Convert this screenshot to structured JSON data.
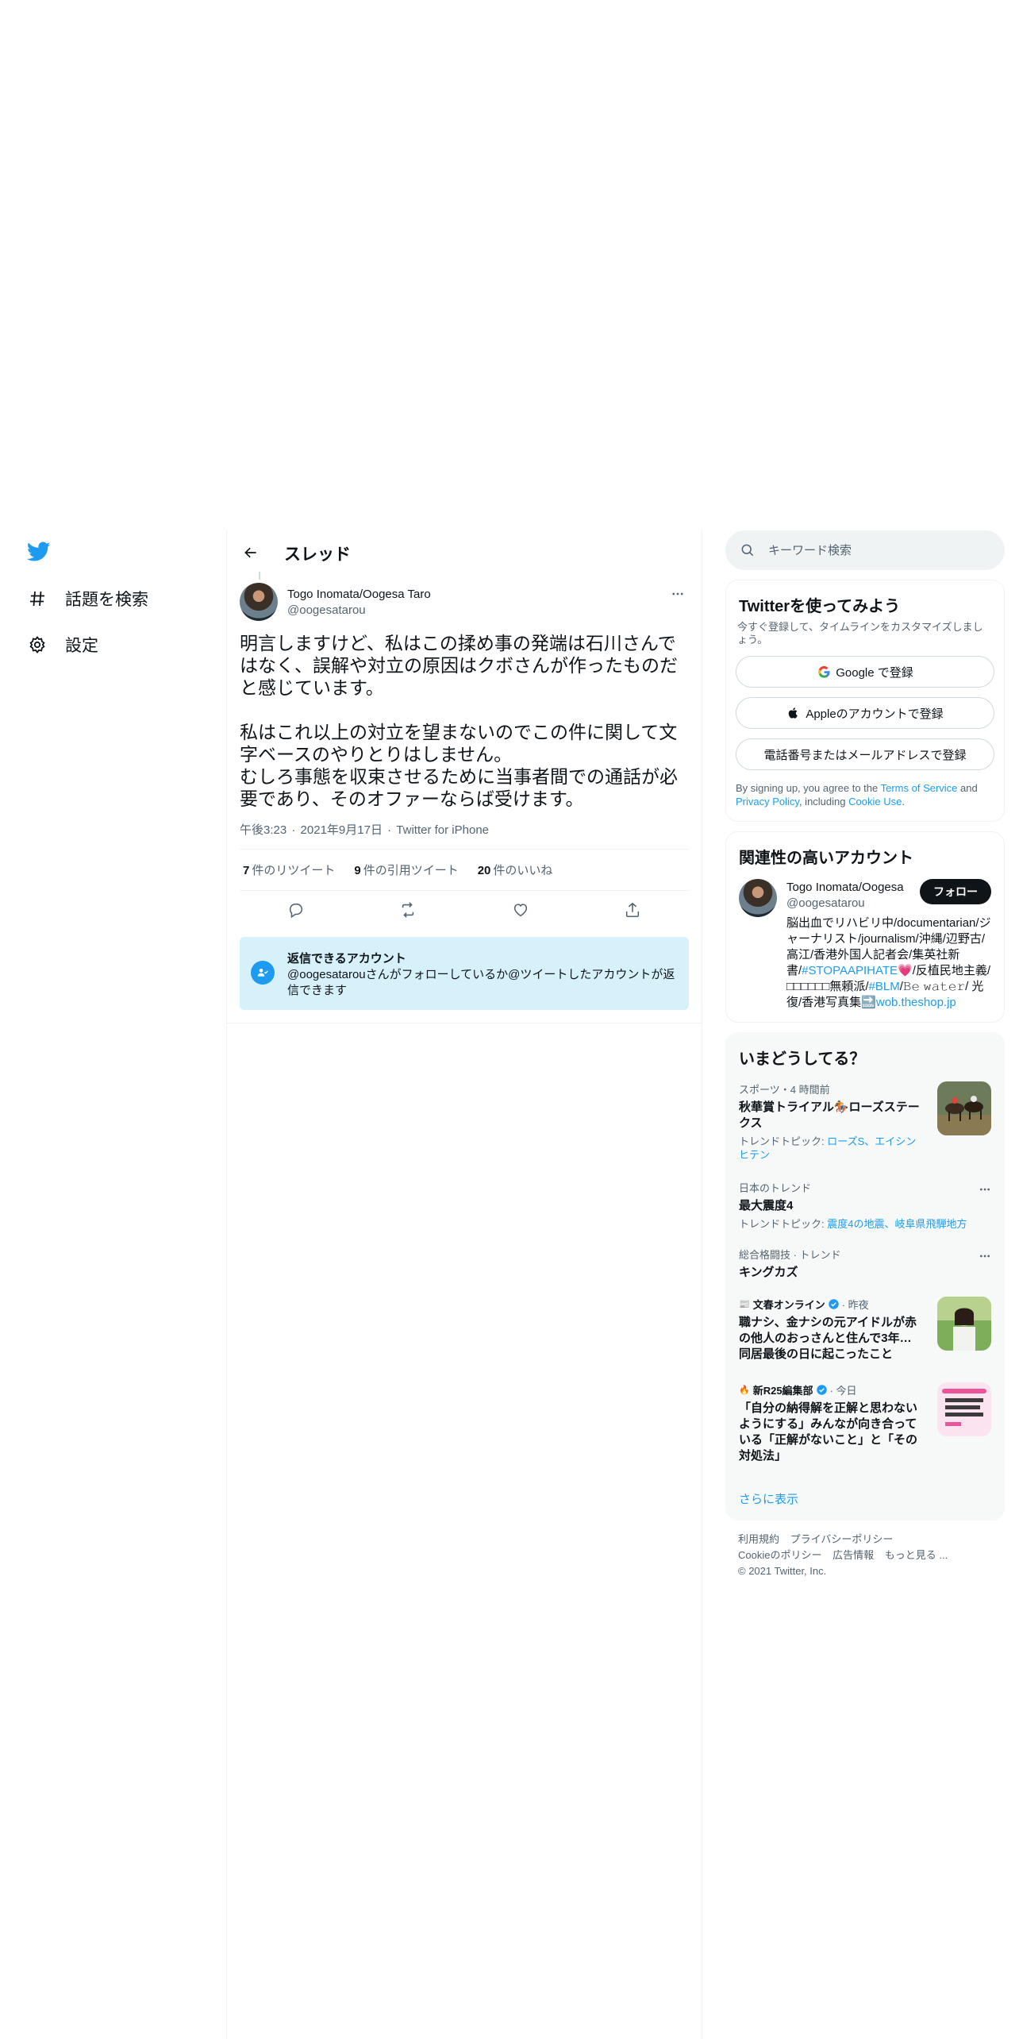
{
  "nav": {
    "logo_icon": "twitter-bird-icon",
    "items": [
      {
        "label": "話題を検索",
        "icon": "hashtag-icon"
      },
      {
        "label": "設定",
        "icon": "gear-icon"
      }
    ]
  },
  "header": {
    "title": "スレッド"
  },
  "tweet": {
    "author_name": "Togo Inomata/Oogesa Taro",
    "author_handle": "@oogesatarou",
    "text": "明言しますけど、私はこの揉め事の発端は石川さんではなく、誤解や対立の原因はクボさんが作ったものだと感じています。\n\n私はこれ以上の対立を望まないのでこの件に関して文字ベースのやりとりはしません。\nむしろ事態を収束させるために当事者間での通話が必要であり、そのオファーならば受けます。",
    "time": "午後3:23",
    "date": "2021年9月17日",
    "client": "Twitter for iPhone",
    "sep": "·",
    "retweets": {
      "count": "7",
      "label": "件のリツイート"
    },
    "quotes": {
      "count": "9",
      "label": "件の引用ツイート"
    },
    "likes": {
      "count": "20",
      "label": "件のいいね"
    }
  },
  "reply_box": {
    "title": "返信できるアカウント",
    "desc": "@oogesatarouさんがフォローしているか@ツイートしたアカウントが返信できます"
  },
  "search": {
    "placeholder": "キーワード検索"
  },
  "signup": {
    "title": "Twitterを使ってみよう",
    "sub": "今すぐ登録して、タイムラインをカスタマイズしましょう。",
    "google": "Google で登録",
    "apple": "Appleのアカウントで登録",
    "phone": "電話番号またはメールアドレスで登録",
    "terms_pre": "By signing up, you agree to the ",
    "terms_tos": "Terms of Service",
    "terms_and": " and ",
    "terms_privacy": "Privacy Policy",
    "terms_incl": ", including ",
    "terms_cookie": "Cookie Use",
    "terms_end": "."
  },
  "related": {
    "title": "関連性の高いアカウント",
    "name": "Togo Inomata/Oogesa Taro",
    "handle": "@oogesatarou",
    "follow": "フォロー",
    "bio_1": "脳出血でリハビリ中/documentarian/ジャーナリスト/journalism/沖縄/辺野古/高江/香港外国人記者会/集英社新書/",
    "bio_hashtag1": "#STOPAAPIHATE",
    "bio_2": "💗/反植民地主義/□□□□□□無頼派/",
    "bio_hashtag2": "#BLM",
    "bio_3": "/𝙱𝚎 𝚠𝚊𝚝𝚎𝚛/ 光復/香港写真集🔜",
    "bio_link": "wob.theshop.jp"
  },
  "trends": {
    "title": "いまどうしてる？",
    "items": [
      {
        "meta": "スポーツ・4 時間前",
        "name": "秋華賞トライアル🏇ローズステークス",
        "topic_label": "トレンドトピック: ",
        "topic_links": "ローズS、エイシンヒテン"
      },
      {
        "meta": "日本のトレンド",
        "name": "最大震度4",
        "topic_label": "トレンドトピック: ",
        "topic_links": "震度4の地震、岐阜県飛騨地方"
      },
      {
        "meta": "総合格闘技 · トレンド",
        "name": "キングカズ"
      },
      {
        "source": "文春オンライン",
        "time": "· 昨夜",
        "name": "職ナシ、金ナシの元アイドルが赤の他人のおっさんと住んで3年…同居最後の日に起こったこと"
      },
      {
        "source": "新R25編集部",
        "time": "· 今日",
        "name": "「自分の納得解を正解と思わないようにする」みんなが向き合っている「正解がないこと」と「その対処法」"
      }
    ],
    "show_more": "さらに表示"
  },
  "footer": {
    "links_1": [
      "利用規約",
      "プライバシーポリシー"
    ],
    "links_2": [
      "Cookieのポリシー",
      "広告情報",
      "もっと見る ..."
    ],
    "copyright": "© 2021 Twitter, Inc."
  },
  "colors": {
    "accent": "#1d9bf0",
    "text": "#0f1419",
    "muted": "#536471",
    "reply_bg": "#d7f1fb"
  }
}
